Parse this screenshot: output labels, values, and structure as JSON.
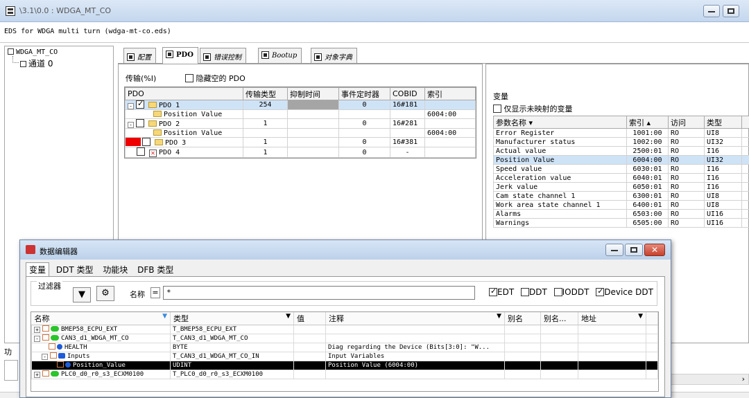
{
  "window": {
    "title": "\\3.1\\0.0 : WDGA_MT_CO",
    "eds_line": "EDS for WDGA multi turn (wdga-mt-co.eds)"
  },
  "tree": {
    "root": "WDGA_MT_CO",
    "child": "通道 0"
  },
  "tabs": [
    {
      "label": "配置"
    },
    {
      "label": "PDO"
    },
    {
      "label": "错误控制"
    },
    {
      "label": "Bootup"
    },
    {
      "label": "对象字典"
    }
  ],
  "pdo_panel": {
    "caption": "传输(%I)",
    "hide_empty_label": "隐藏空的 PDO",
    "columns": [
      "PDO",
      "传输类型",
      "抑制时间",
      "事件定时器",
      "COBID",
      "索引"
    ],
    "rows": [
      {
        "name": "PDO 1",
        "type": "254",
        "inhibit": "",
        "timer": "0",
        "cobid": "16#181",
        "index": ""
      },
      {
        "name": "Position Value",
        "type": "",
        "inhibit": "",
        "timer": "",
        "cobid": "",
        "index": "6004:00"
      },
      {
        "name": "PDO 2",
        "type": "1",
        "inhibit": "",
        "timer": "0",
        "cobid": "16#281",
        "index": ""
      },
      {
        "name": "Position Value",
        "type": "",
        "inhibit": "",
        "timer": "",
        "cobid": "",
        "index": "6004:00"
      },
      {
        "name": "PDO 3",
        "type": "1",
        "inhibit": "",
        "timer": "0",
        "cobid": "16#381",
        "index": ""
      },
      {
        "name": "PDO 4",
        "type": "1",
        "inhibit": "",
        "timer": "0",
        "cobid": "-",
        "index": ""
      }
    ]
  },
  "var_panel": {
    "caption": "变量",
    "only_unmapped_label": "仅显示未映射的变量",
    "columns": [
      "参数名称 ▾",
      "索引 ▴",
      "访问",
      "类型"
    ],
    "rows": [
      {
        "name": "Error Register",
        "index": "1001:00",
        "access": "RO",
        "type": "UI8"
      },
      {
        "name": "Manufacturer status",
        "index": "1002:00",
        "access": "RO",
        "type": "UI32"
      },
      {
        "name": "Actual value",
        "index": "2500:01",
        "access": "RO",
        "type": "I16"
      },
      {
        "name": "Position Value",
        "index": "6004:00",
        "access": "RO",
        "type": "UI32"
      },
      {
        "name": "Speed value",
        "index": "6030:01",
        "access": "RO",
        "type": "I16"
      },
      {
        "name": "Acceleration value",
        "index": "6040:01",
        "access": "RO",
        "type": "I16"
      },
      {
        "name": "Jerk value",
        "index": "6050:01",
        "access": "RO",
        "type": "I16"
      },
      {
        "name": "Cam state channel 1",
        "index": "6300:01",
        "access": "RO",
        "type": "UI8"
      },
      {
        "name": "Work area state channel 1",
        "index": "6400:01",
        "access": "RO",
        "type": "UI8"
      },
      {
        "name": "Alarms",
        "index": "6503:00",
        "access": "RO",
        "type": "UI16"
      },
      {
        "name": "Warnings",
        "index": "6505:00",
        "access": "RO",
        "type": "UI16"
      }
    ]
  },
  "left_stub": {
    "label": "功"
  },
  "dialog": {
    "title": "数据编辑器",
    "tabs": [
      "变量",
      "DDT 类型",
      "功能块",
      "DFB 类型"
    ],
    "filter_label": "过滤器",
    "name_label": "名称",
    "eq": "=",
    "name_value": "*",
    "options": [
      {
        "label": "EDT",
        "checked": true
      },
      {
        "label": "DDT",
        "checked": false
      },
      {
        "label": "IODDT",
        "checked": false
      },
      {
        "label": "Device DDT",
        "checked": true
      }
    ],
    "columns": [
      "名称",
      "类型",
      "值",
      "注释",
      "别名",
      "别名...",
      "地址"
    ],
    "rows": [
      {
        "name": "BMEP58_ECPU_EXT",
        "type": "T_BMEP58_ECPU_EXT",
        "value": "",
        "comment": "",
        "pm": "+"
      },
      {
        "name": "CAN3_d1_WDGA_MT_CO",
        "type": "T_CAN3_d1_WDGA_MT_CO",
        "value": "",
        "comment": "",
        "pm": "-"
      },
      {
        "name": "HEALTH",
        "type": "BYTE",
        "value": "",
        "comment": "Diag regarding the Device (Bits[3:0]: \"W...",
        "pm": ""
      },
      {
        "name": "Inputs",
        "type": "T_CAN3_d1_WDGA_MT_CO_IN",
        "value": "",
        "comment": "Input Variables",
        "pm": "-"
      },
      {
        "name": "Position_Value",
        "type": "UDINT",
        "value": "",
        "comment": "Position Value (6004:00)",
        "pm": ""
      },
      {
        "name": "PLC0_d0_r0_s3_ECXM0100",
        "type": "T_PLC0_d0_r0_s3_ECXM0100",
        "value": "",
        "comment": "",
        "pm": "+"
      }
    ]
  }
}
